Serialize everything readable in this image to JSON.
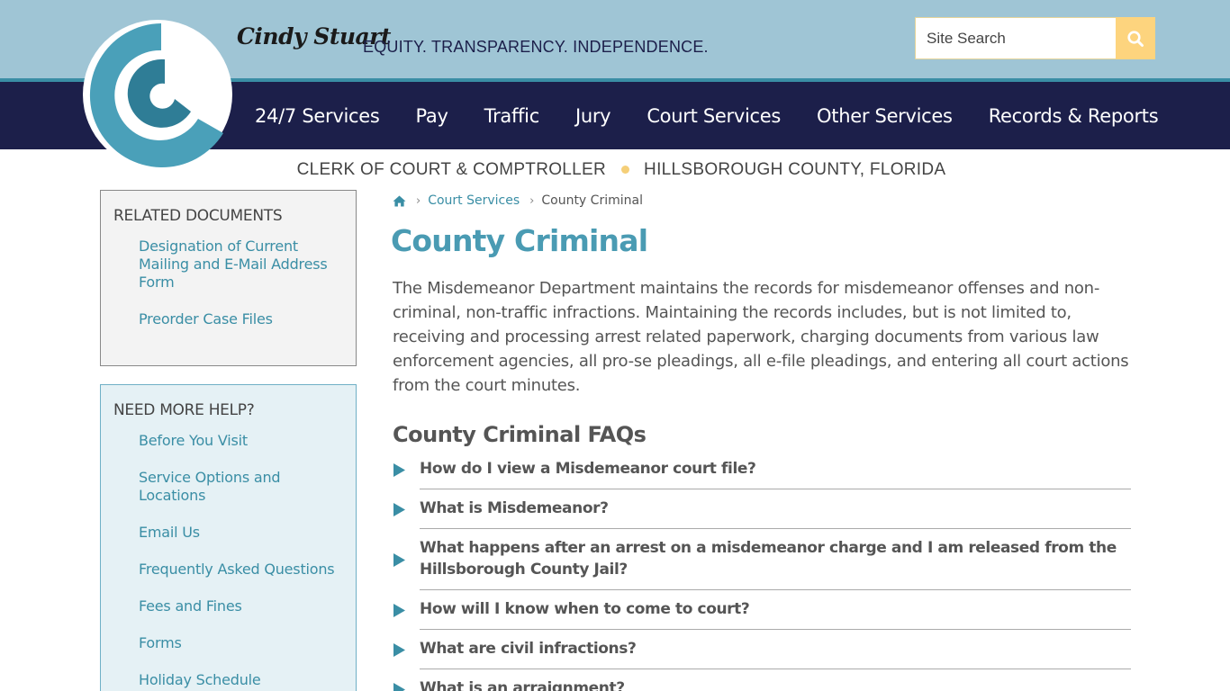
{
  "header": {
    "signature": "Cindy Stuart",
    "tagline": "EQUITY. TRANSPARENCY. INDEPENDENCE.",
    "search": {
      "placeholder": "Site Search"
    },
    "nav": [
      {
        "label": "24/7 Services"
      },
      {
        "label": "Pay"
      },
      {
        "label": "Traffic"
      },
      {
        "label": "Jury"
      },
      {
        "label": "Court Services"
      },
      {
        "label": "Other Services"
      },
      {
        "label": "Records & Reports"
      }
    ],
    "subtitle_left": "CLERK OF COURT & COMPTROLLER",
    "subtitle_right": "HILLSBOROUGH COUNTY, FLORIDA"
  },
  "sidebar": {
    "related": {
      "heading": "RELATED DOCUMENTS",
      "items": [
        {
          "label": "Designation of Current Mailing and E-Mail Address Form"
        },
        {
          "label": "Preorder Case Files"
        }
      ]
    },
    "help": {
      "heading": "NEED MORE HELP?",
      "items": [
        {
          "label": "Before You Visit"
        },
        {
          "label": "Service Options and Locations"
        },
        {
          "label": "Email Us"
        },
        {
          "label": "Frequently Asked Questions"
        },
        {
          "label": "Fees and Fines"
        },
        {
          "label": "Forms"
        },
        {
          "label": "Holiday Schedule"
        }
      ]
    }
  },
  "breadcrumb": {
    "home_icon": "home-icon",
    "items": [
      {
        "label": "Court Services"
      },
      {
        "label": "County Criminal"
      }
    ]
  },
  "main": {
    "title": "County Criminal",
    "intro": "The Misdemeanor Department maintains the records for misdemeanor offenses and non-criminal, non-traffic infractions. Maintaining the records includes, but is not limited to, receiving and processing arrest related paperwork, charging documents from various law enforcement agencies, all pro-se pleadings, all e-file pleadings, and entering all court actions from the court minutes.",
    "faq_heading": "County Criminal FAQs",
    "faqs": [
      {
        "question": "How do I view a Misdemeanor court file?"
      },
      {
        "question": "What is Misdemeanor?"
      },
      {
        "question": "What happens after an arrest on a misdemeanor charge and I am released from the Hillsborough County Jail?"
      },
      {
        "question": "How will I know when to come to court?"
      },
      {
        "question": "What are civil infractions?"
      },
      {
        "question": "What is an arraignment?"
      }
    ]
  },
  "colors": {
    "top_band": "#9fc5d5",
    "nav_band": "#1c1f4a",
    "accent_teal": "#3a8ea5",
    "title_teal": "#4a9bb3",
    "search_button": "#fdd47e",
    "dot_gold": "#f5cf78"
  }
}
